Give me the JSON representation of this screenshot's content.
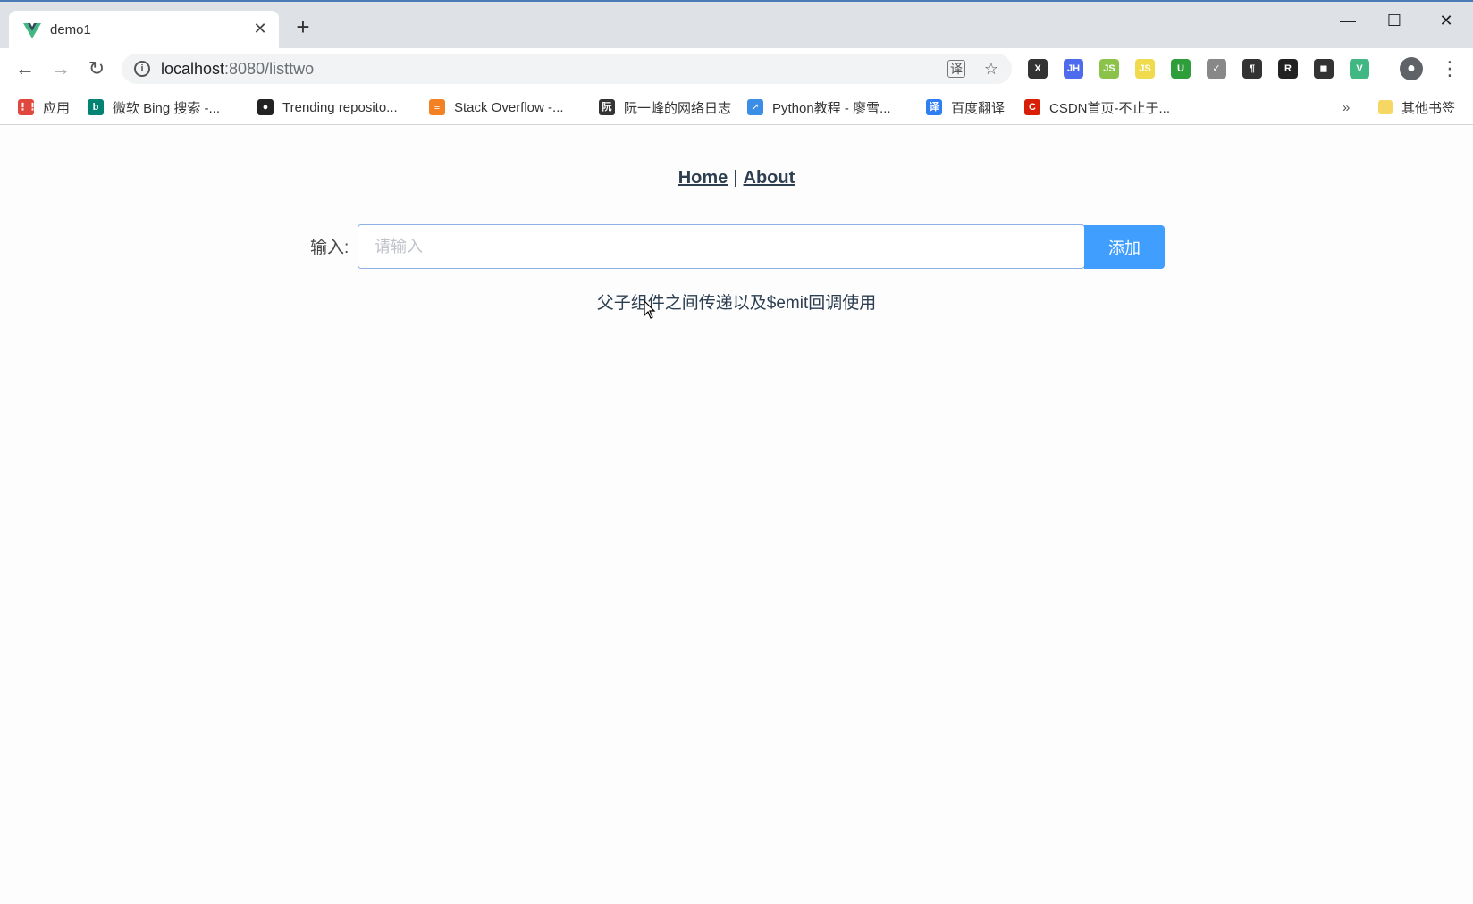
{
  "browser": {
    "tab_title": "demo1",
    "tab_close": "✕",
    "new_tab": "+",
    "window_minimize": "—",
    "window_maximize": "☐",
    "window_close": "✕",
    "url_host": "localhost",
    "url_path": ":8080/listtwo",
    "nav_back": "←",
    "nav_forward": "→",
    "nav_reload": "↻",
    "menu": "⋮",
    "bookmark_star": "☆",
    "extensions_overflow": "»",
    "extensions": [
      {
        "icon": "x-extension-icon",
        "label": "X",
        "color": "#333333"
      },
      {
        "icon": "jh-extension-icon",
        "label": "JH",
        "color": "#4f6bed"
      },
      {
        "icon": "js-green-extension-icon",
        "label": "JS",
        "color": "#8bc34a"
      },
      {
        "icon": "js-yellow-extension-icon",
        "label": "JS",
        "color": "#f0db4f"
      },
      {
        "icon": "shield-extension-icon",
        "label": "U",
        "color": "#2e9e3a"
      },
      {
        "icon": "check-extension-icon",
        "label": "✓",
        "color": "#888888"
      },
      {
        "icon": "pilcrow-extension-icon",
        "label": "¶",
        "color": "#333333"
      },
      {
        "icon": "r-extension-icon",
        "label": "R",
        "color": "#222222"
      },
      {
        "icon": "octopus-extension-icon",
        "label": "◼",
        "color": "#333333"
      },
      {
        "icon": "vue-extension-icon",
        "label": "V",
        "color": "#41b883"
      }
    ],
    "bookmarks": [
      {
        "label": "应用",
        "icon": "apps-grid-icon",
        "color": "#e0483e",
        "glyph": "⋮⋮"
      },
      {
        "label": "微软 Bing 搜索 -...",
        "icon": "bing-icon",
        "color": "#008373",
        "glyph": "b"
      },
      {
        "label": "Trending reposito...",
        "icon": "github-icon",
        "color": "#222222",
        "glyph": "●"
      },
      {
        "label": "Stack Overflow -...",
        "icon": "stackoverflow-icon",
        "color": "#f48024",
        "glyph": "≡"
      },
      {
        "label": "阮一峰的网络日志",
        "icon": "ruanyifeng-icon",
        "color": "#333333",
        "glyph": "阮"
      },
      {
        "label": "Python教程 - 廖雪...",
        "icon": "rocket-icon",
        "color": "#3a8ee6",
        "glyph": "➚"
      },
      {
        "label": "百度翻译",
        "icon": "baidu-translate-icon",
        "color": "#2f7ff3",
        "glyph": "译"
      },
      {
        "label": "CSDN首页-不止于...",
        "icon": "csdn-icon",
        "color": "#d81e06",
        "glyph": "C"
      }
    ],
    "other_bookmarks": "其他书签"
  },
  "page": {
    "nav_home": "Home",
    "nav_separator": "|",
    "nav_about": "About",
    "input_label": "输入:",
    "input_placeholder": "请输入",
    "input_value": "",
    "add_button": "添加",
    "caption": "父子组件之间传递以及$emit回调使用"
  }
}
